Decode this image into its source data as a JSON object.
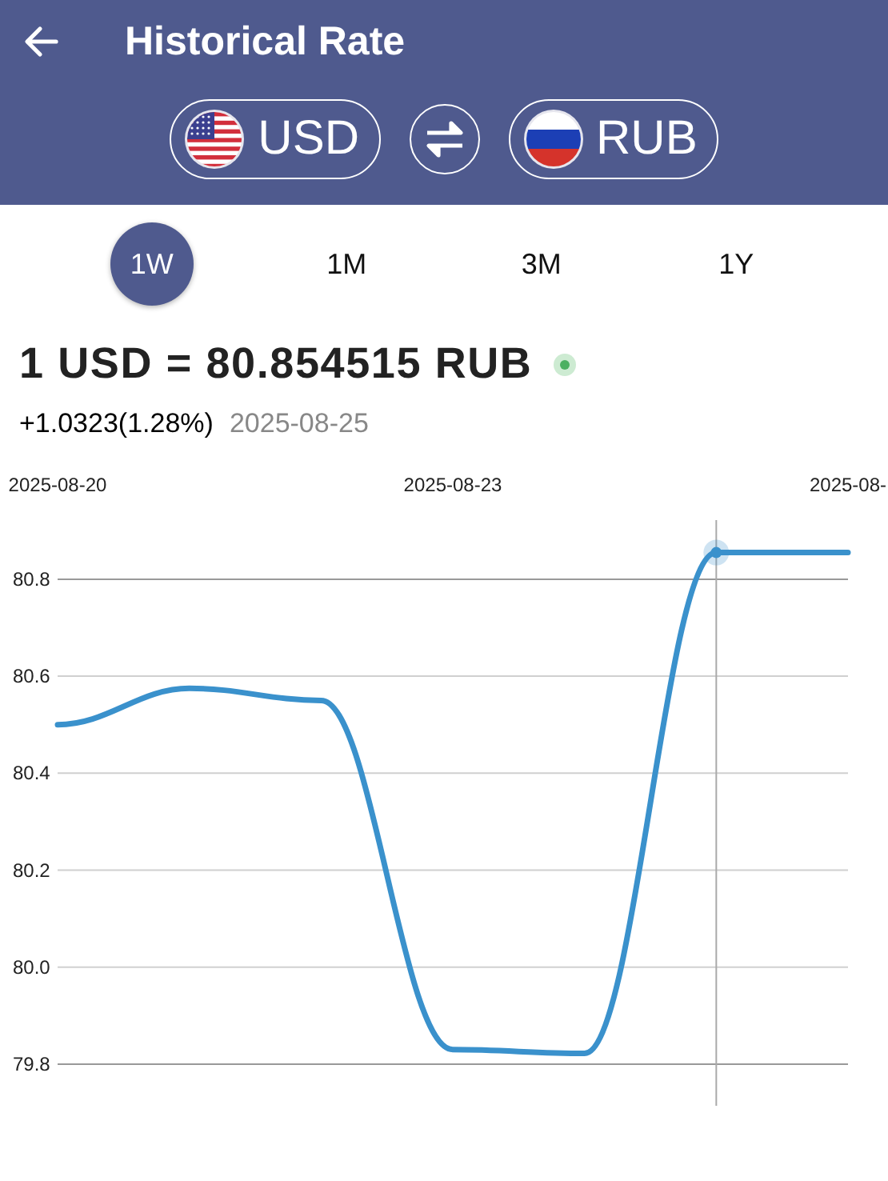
{
  "header": {
    "title": "Historical Rate",
    "base": {
      "code": "USD"
    },
    "quote": {
      "code": "RUB"
    }
  },
  "periods": [
    {
      "label": "1W",
      "selected": true
    },
    {
      "label": "1M",
      "selected": false
    },
    {
      "label": "3M",
      "selected": false
    },
    {
      "label": "1Y",
      "selected": false
    }
  ],
  "rate": {
    "text": "1 USD = 80.854515 RUB",
    "live": true
  },
  "change": {
    "text": "+1.0323(1.28%)",
    "date": "2025-08-25"
  },
  "chart_data": {
    "type": "line",
    "categories": [
      "2025-08-20",
      null,
      null,
      "2025-08-23",
      null,
      null,
      "2025-08-"
    ],
    "series": [
      {
        "color": "#3a91cc",
        "values": [
          80.5,
          80.575,
          80.55,
          79.83,
          79.822,
          80.855,
          80.855
        ]
      }
    ],
    "yticks": [
      79.8,
      {
        "value": 80,
        "label": "80.0"
      },
      80.2,
      80.4,
      80.6,
      80.8
    ],
    "ylim": [
      79.714,
      80.922
    ],
    "grid": true
  }
}
